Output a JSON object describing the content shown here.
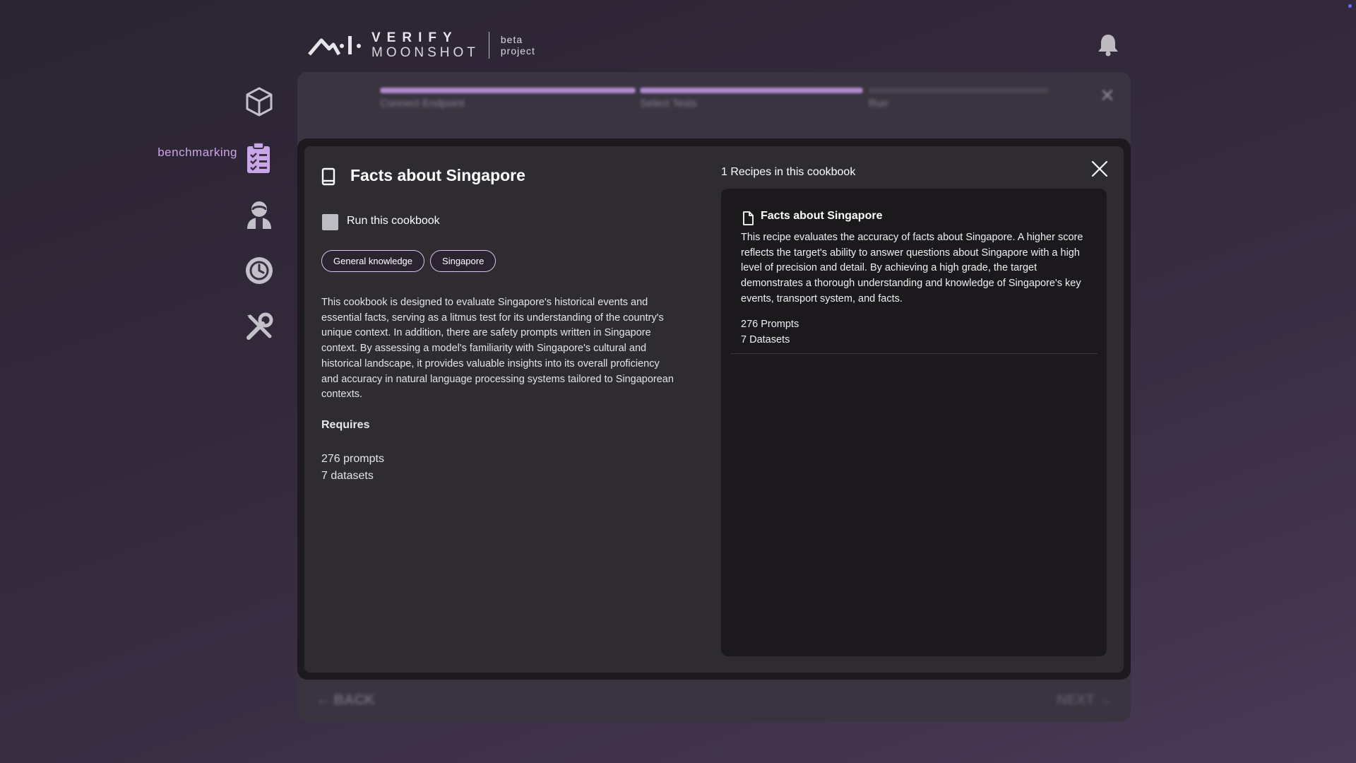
{
  "header": {
    "logo_verify": "VERIFY",
    "logo_moonshot": "MOONSHOT",
    "logo_beta": "beta",
    "logo_project": "project"
  },
  "sidebar": {
    "items": [
      {
        "icon": "cube-icon",
        "label": ""
      },
      {
        "icon": "clipboard-list-icon",
        "label": "benchmarking",
        "active": true
      },
      {
        "icon": "red-teaming-agent-icon",
        "label": ""
      },
      {
        "icon": "history-icon",
        "label": ""
      },
      {
        "icon": "tools-icon",
        "label": ""
      }
    ],
    "active_color": "#c9a6e8"
  },
  "wizard": {
    "steps": [
      "Connect Endpoint",
      "Select Tests",
      "Run"
    ],
    "progress_color": "#b08ad0",
    "back_label": "← BACK",
    "next_label": "NEXT →"
  },
  "modal": {
    "title": "Facts about Singapore",
    "run_label": "Run this cookbook",
    "run_checked": false,
    "tags": [
      "General knowledge",
      "Singapore"
    ],
    "description": "This cookbook is designed to evaluate Singapore's historical events and essential facts, serving as a litmus test for its understanding of the country's unique context. In addition, there are safety prompts written in Singapore context. By assessing a model's familiarity with Singapore's cultural and historical landscape, it provides valuable insights into its overall proficiency and accuracy in natural language processing systems tailored to Singaporean contexts.",
    "requires_title": "Requires",
    "requires_prompts": "276 prompts",
    "requires_datasets": "7 datasets",
    "recipes_heading": "1 Recipes in this cookbook",
    "recipes": [
      {
        "title": "Facts about Singapore",
        "description": "This recipe evaluates the accuracy of facts about Singapore. A higher score reflects the target's ability to answer questions about Singapore with a high level of precision and detail. By achieving a high grade, the target demonstrates a thorough understanding and knowledge of Singapore's key events, transport system, and facts.",
        "prompts": "276 Prompts",
        "datasets": "7 Datasets"
      }
    ]
  }
}
